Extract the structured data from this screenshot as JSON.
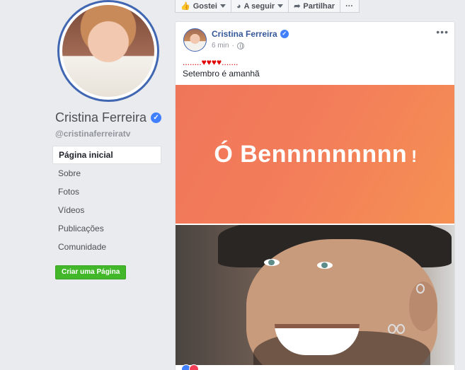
{
  "sidebar": {
    "page_name": "Cristina Ferreira",
    "handle": "@cristinaferreiratv",
    "nav": [
      {
        "label": "Página inicial",
        "active": true
      },
      {
        "label": "Sobre"
      },
      {
        "label": "Fotos"
      },
      {
        "label": "Vídeos"
      },
      {
        "label": "Publicações"
      },
      {
        "label": "Comunidade"
      }
    ],
    "create_page_label": "Criar uma Página"
  },
  "action_bar": {
    "like_label": "Gostei",
    "follow_label": "A seguir",
    "share_label": "Partilhar",
    "more_label": "···"
  },
  "post": {
    "author": "Cristina Ferreira",
    "time": "6 min",
    "line1": "........♥♥♥♥.......",
    "line2": "Setembro é amanhã",
    "banner_text": "Ó Bennnnnnnnn",
    "banner_bang": "!",
    "more_label": "•••"
  },
  "colors": {
    "brand_blue": "#4267b2",
    "link_blue": "#365899",
    "green": "#42b72a",
    "banner": "#f37e5a",
    "verified": "#4080ff"
  }
}
